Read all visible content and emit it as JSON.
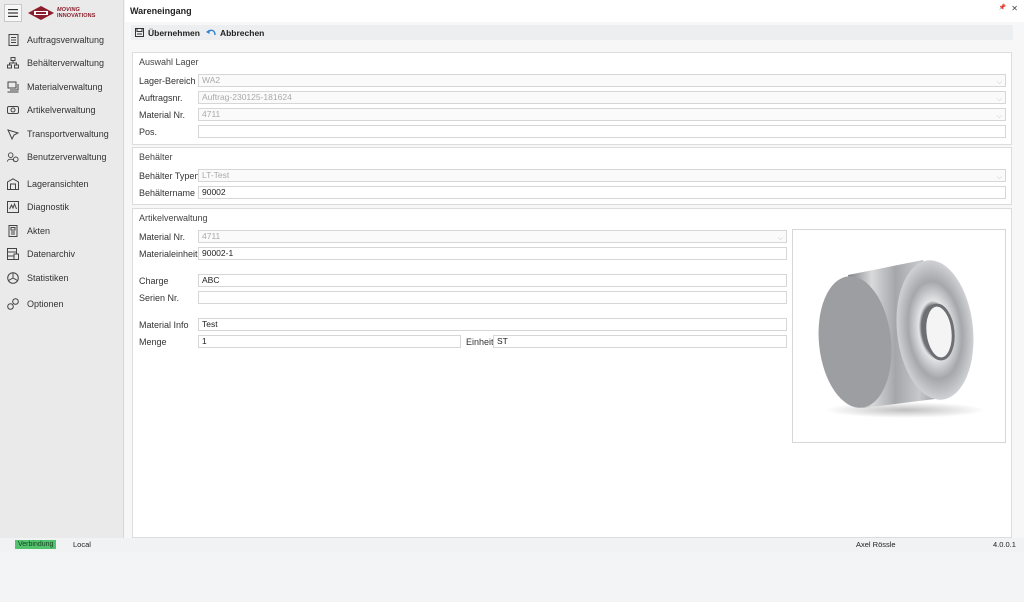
{
  "brand": {
    "line1": "MOVING",
    "line2": "INNOVATIONS"
  },
  "sidebar": {
    "items": [
      {
        "label": "Auftragsverwaltung",
        "icon": "document-list-icon"
      },
      {
        "label": "Behälterverwaltung",
        "icon": "container-hierarchy-icon"
      },
      {
        "label": "Materialverwaltung",
        "icon": "material-stack-icon"
      },
      {
        "label": "Artikelverwaltung",
        "icon": "article-icon"
      },
      {
        "label": "Transportverwaltung",
        "icon": "transport-icon"
      },
      {
        "label": "Benutzerverwaltung",
        "icon": "users-icon"
      },
      {
        "label": "Lageransichten",
        "icon": "warehouse-icon"
      },
      {
        "label": "Diagnostik",
        "icon": "diagnostics-icon"
      },
      {
        "label": "Akten",
        "icon": "files-icon"
      },
      {
        "label": "Datenarchiv",
        "icon": "archive-icon"
      },
      {
        "label": "Statistiken",
        "icon": "pie-chart-icon"
      },
      {
        "label": "Optionen",
        "icon": "options-icon"
      }
    ]
  },
  "window": {
    "title": "Wareneingang",
    "pin": "📌",
    "close": "✕"
  },
  "toolbar": {
    "apply_label": "Übernehmen",
    "cancel_label": "Abbrechen"
  },
  "lager": {
    "title": "Auswahl Lager",
    "lager_bereich_label": "Lager-Bereich",
    "lager_bereich_value": "WA2",
    "auftragsnr_label": "Auftragsnr.",
    "auftragsnr_value": "Auftrag-230125-181624",
    "material_nr_label": "Material Nr.",
    "material_nr_value": "4711",
    "pos_label": "Pos.",
    "pos_value": ""
  },
  "behaelter": {
    "title": "Behälter",
    "typen_label": "Behälter Typen",
    "typen_value": "LT-Test",
    "name_label": "Behältername",
    "name_value": "90002"
  },
  "artikel": {
    "title": "Artikelverwaltung",
    "material_nr_label": "Material Nr.",
    "material_nr_value": "4711",
    "materialeinheit_label": "Materialeinheit",
    "materialeinheit_value": "90002-1",
    "charge_label": "Charge",
    "charge_value": "ABC",
    "serien_label": "Serien Nr.",
    "serien_value": "",
    "info_label": "Material Info",
    "info_value": "Test",
    "menge_label": "Menge",
    "menge_value": "1",
    "einheit_label": "Einheit",
    "einheit_value": "ST"
  },
  "status": {
    "connection": "Verbindung",
    "mode": "Local",
    "user": "Axel Rössle",
    "version": "4.0.0.1",
    "connection_color": "#52c26e"
  }
}
